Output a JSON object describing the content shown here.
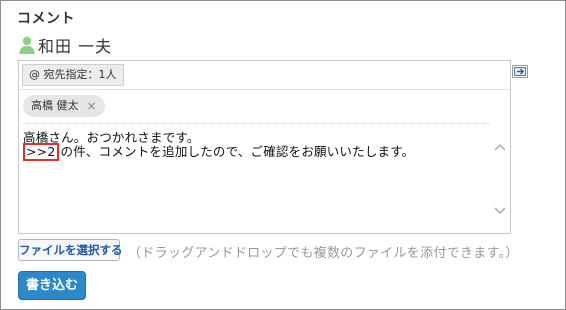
{
  "section": {
    "title": "コメント"
  },
  "author": {
    "name": "和田 一夫",
    "icon": "user-icon"
  },
  "destination": {
    "button_label": "@ 宛先指定：1人"
  },
  "recipients": [
    {
      "name": "高橋 健太",
      "remove": "×"
    }
  ],
  "comment": {
    "line1": "高橋さん。おつかれさまです。",
    "line2_ref": ">>2",
    "line2_rest": "の件、コメントを追加したので、ご確認をお願いいたします。"
  },
  "attachments": {
    "button_label": "ファイルを選択する",
    "hint": "（ドラッグアンドドロップでも複数のファイルを添付できます。）"
  },
  "actions": {
    "submit_label": "書き込む"
  },
  "colors": {
    "accent": "#2b88c9",
    "highlight": "#e03030",
    "user_icon": "#8ecf8a"
  }
}
